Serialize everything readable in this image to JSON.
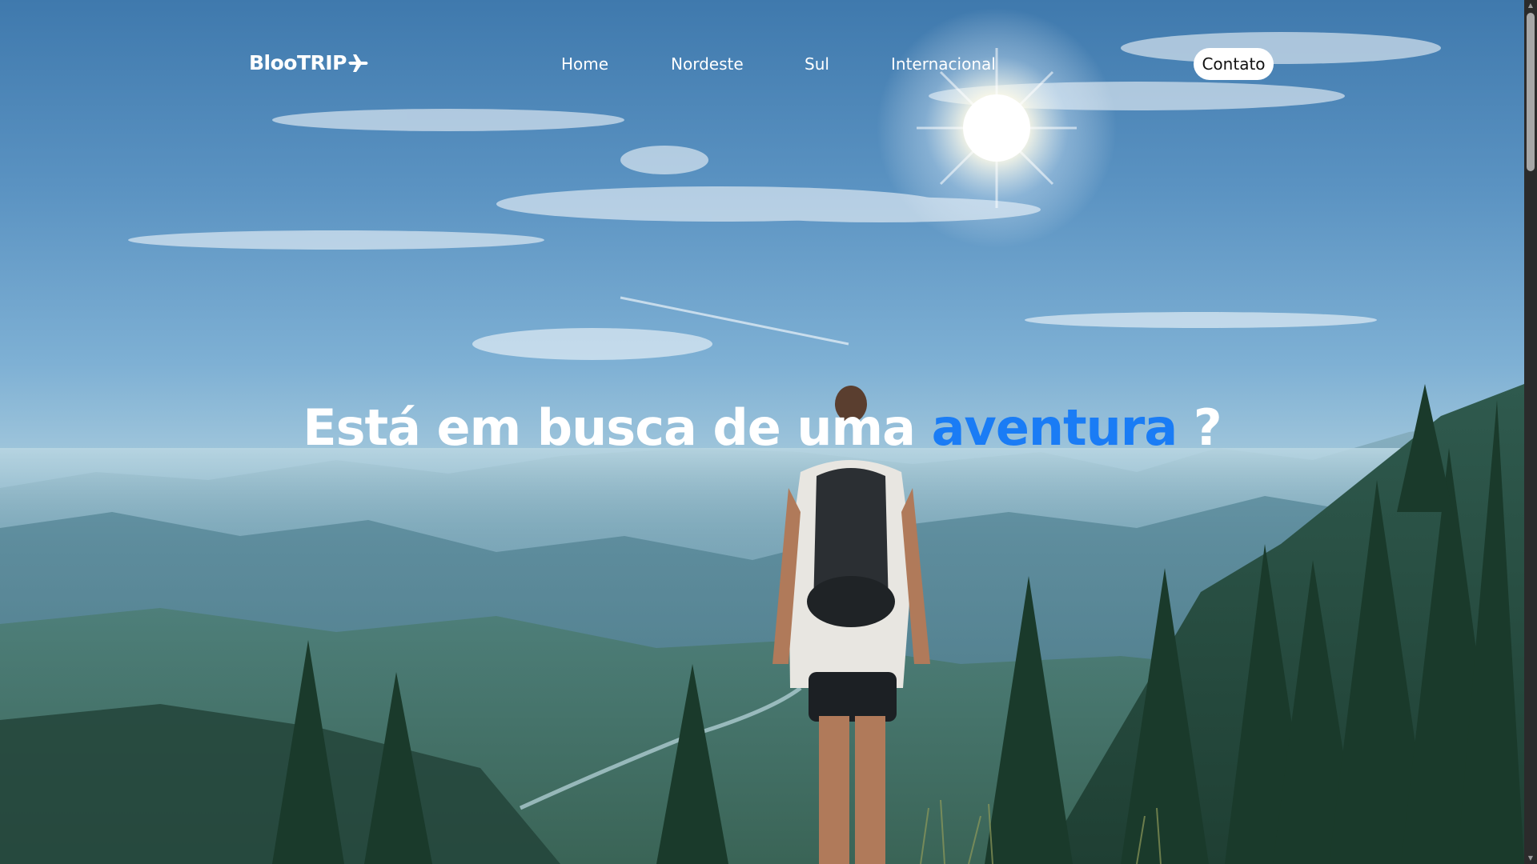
{
  "brand": {
    "name": "BlooTRIP",
    "icon": "airplane-icon"
  },
  "nav": {
    "links": [
      {
        "label": "Home"
      },
      {
        "label": "Nordeste"
      },
      {
        "label": "Sul"
      },
      {
        "label": "Internacional"
      }
    ],
    "contact_label": "Contato"
  },
  "hero": {
    "headline_before": "Está em busca de uma ",
    "headline_accent": "aventura",
    "headline_after": " ?",
    "accent_color": "#1a7cf5"
  },
  "colors": {
    "text": "#ffffff",
    "button_bg": "#ffffff",
    "button_text": "#111111"
  }
}
